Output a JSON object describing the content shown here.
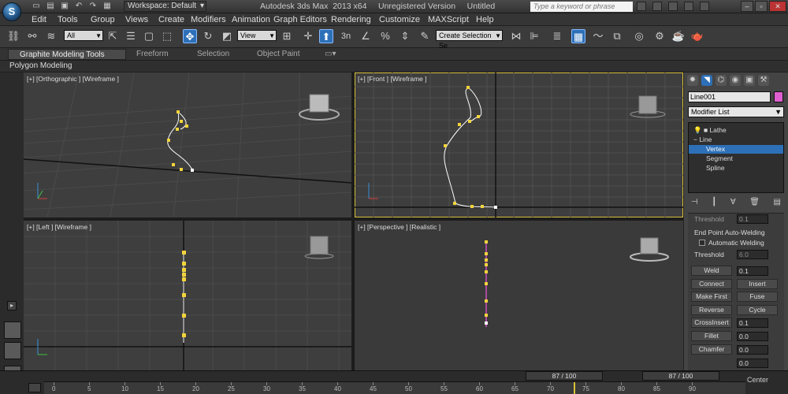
{
  "title": {
    "logo": "S",
    "workspace": "Workspace: Default",
    "window": "Autodesk 3ds Max  2013 x64     Unregistered Version     Untitled",
    "search_placeholder": "Type a keyword or phrase"
  },
  "menu": [
    "Edit",
    "Tools",
    "Group",
    "Views",
    "Create",
    "Modifiers",
    "Animation",
    "Graph Editors",
    "Rendering",
    "Customize",
    "MAXScript",
    "Help"
  ],
  "toolbar": {
    "filter_value": "All",
    "refcoord_value": "View",
    "selset_value": "Create Selection Se",
    "snap_3": "3",
    "snap_n": "n",
    "active_tool": "select-and-move"
  },
  "ribbon": {
    "tabs": [
      "Graphite Modeling Tools",
      "Freeform",
      "Selection",
      "Object Paint"
    ],
    "sub": "Polygon Modeling"
  },
  "viewports": [
    {
      "label": "[+] [Orthographic ] [Wireframe ]",
      "active": false,
      "cube": "FRONT"
    },
    {
      "label": "[+] [Front ] [Wireframe ]",
      "active": true,
      "cube": "FRONT"
    },
    {
      "label": "[+] [Left ] [Wireframe ]",
      "active": false,
      "cube": "LEFT"
    },
    {
      "label": "[+] [Perspective ] [Realistic ]",
      "active": false,
      "cube": "FRONT"
    }
  ],
  "command_panel": {
    "object_name": "Line001",
    "object_color": "#e05fd0",
    "modifier_list": "Modifier List",
    "stack": [
      "Lathe",
      "Line",
      "Vertex",
      "Segment",
      "Spline"
    ],
    "stack_selected": "Vertex",
    "rollout": {
      "threshold_top": "Threshold",
      "threshold_top_value": "0.1",
      "group": "End Point Auto-Welding",
      "auto_weld": "Automatic Welding",
      "threshold": "Threshold",
      "threshold_value": "6.0",
      "weld": "Weld",
      "weld_value": "0.1",
      "connect": "Connect",
      "insert": "Insert",
      "make_first": "Make First",
      "fuse": "Fuse",
      "reverse": "Reverse",
      "cycle": "Cycle",
      "crossinsert": "CrossInsert",
      "crossinsert_value": "0.1",
      "fillet": "Fillet",
      "fillet_value": "0.0",
      "chamfer": "Chamfer",
      "chamfer_value": "0.0",
      "extra_value": "0.0"
    }
  },
  "timeline": {
    "frame_left": "87 / 100",
    "frame_right": "87 / 100",
    "ticks": [
      "0",
      "5",
      "10",
      "15",
      "20",
      "25",
      "30",
      "35",
      "40",
      "45",
      "50",
      "55",
      "60",
      "65",
      "70",
      "75",
      "80",
      "85",
      "90"
    ],
    "center_label": "Center"
  },
  "colors": {
    "accent": "#2d70b8",
    "active_viewport": "#d9c03a",
    "vertex": "#f2d43a"
  }
}
